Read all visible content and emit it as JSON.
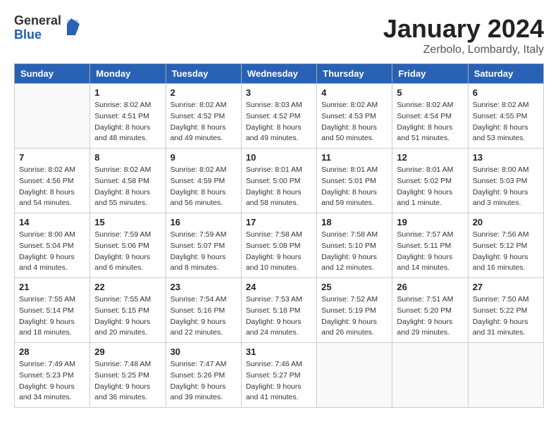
{
  "logo": {
    "general": "General",
    "blue": "Blue"
  },
  "title": "January 2024",
  "location": "Zerbolo, Lombardy, Italy",
  "days_of_week": [
    "Sunday",
    "Monday",
    "Tuesday",
    "Wednesday",
    "Thursday",
    "Friday",
    "Saturday"
  ],
  "weeks": [
    [
      {
        "num": "",
        "rise": "",
        "set": "",
        "daylight": ""
      },
      {
        "num": "1",
        "rise": "Sunrise: 8:02 AM",
        "set": "Sunset: 4:51 PM",
        "daylight": "Daylight: 8 hours and 48 minutes."
      },
      {
        "num": "2",
        "rise": "Sunrise: 8:02 AM",
        "set": "Sunset: 4:52 PM",
        "daylight": "Daylight: 8 hours and 49 minutes."
      },
      {
        "num": "3",
        "rise": "Sunrise: 8:03 AM",
        "set": "Sunset: 4:52 PM",
        "daylight": "Daylight: 8 hours and 49 minutes."
      },
      {
        "num": "4",
        "rise": "Sunrise: 8:02 AM",
        "set": "Sunset: 4:53 PM",
        "daylight": "Daylight: 8 hours and 50 minutes."
      },
      {
        "num": "5",
        "rise": "Sunrise: 8:02 AM",
        "set": "Sunset: 4:54 PM",
        "daylight": "Daylight: 8 hours and 51 minutes."
      },
      {
        "num": "6",
        "rise": "Sunrise: 8:02 AM",
        "set": "Sunset: 4:55 PM",
        "daylight": "Daylight: 8 hours and 53 minutes."
      }
    ],
    [
      {
        "num": "7",
        "rise": "Sunrise: 8:02 AM",
        "set": "Sunset: 4:56 PM",
        "daylight": "Daylight: 8 hours and 54 minutes."
      },
      {
        "num": "8",
        "rise": "Sunrise: 8:02 AM",
        "set": "Sunset: 4:58 PM",
        "daylight": "Daylight: 8 hours and 55 minutes."
      },
      {
        "num": "9",
        "rise": "Sunrise: 8:02 AM",
        "set": "Sunset: 4:59 PM",
        "daylight": "Daylight: 8 hours and 56 minutes."
      },
      {
        "num": "10",
        "rise": "Sunrise: 8:01 AM",
        "set": "Sunset: 5:00 PM",
        "daylight": "Daylight: 8 hours and 58 minutes."
      },
      {
        "num": "11",
        "rise": "Sunrise: 8:01 AM",
        "set": "Sunset: 5:01 PM",
        "daylight": "Daylight: 8 hours and 59 minutes."
      },
      {
        "num": "12",
        "rise": "Sunrise: 8:01 AM",
        "set": "Sunset: 5:02 PM",
        "daylight": "Daylight: 9 hours and 1 minute."
      },
      {
        "num": "13",
        "rise": "Sunrise: 8:00 AM",
        "set": "Sunset: 5:03 PM",
        "daylight": "Daylight: 9 hours and 3 minutes."
      }
    ],
    [
      {
        "num": "14",
        "rise": "Sunrise: 8:00 AM",
        "set": "Sunset: 5:04 PM",
        "daylight": "Daylight: 9 hours and 4 minutes."
      },
      {
        "num": "15",
        "rise": "Sunrise: 7:59 AM",
        "set": "Sunset: 5:06 PM",
        "daylight": "Daylight: 9 hours and 6 minutes."
      },
      {
        "num": "16",
        "rise": "Sunrise: 7:59 AM",
        "set": "Sunset: 5:07 PM",
        "daylight": "Daylight: 9 hours and 8 minutes."
      },
      {
        "num": "17",
        "rise": "Sunrise: 7:58 AM",
        "set": "Sunset: 5:08 PM",
        "daylight": "Daylight: 9 hours and 10 minutes."
      },
      {
        "num": "18",
        "rise": "Sunrise: 7:58 AM",
        "set": "Sunset: 5:10 PM",
        "daylight": "Daylight: 9 hours and 12 minutes."
      },
      {
        "num": "19",
        "rise": "Sunrise: 7:57 AM",
        "set": "Sunset: 5:11 PM",
        "daylight": "Daylight: 9 hours and 14 minutes."
      },
      {
        "num": "20",
        "rise": "Sunrise: 7:56 AM",
        "set": "Sunset: 5:12 PM",
        "daylight": "Daylight: 9 hours and 16 minutes."
      }
    ],
    [
      {
        "num": "21",
        "rise": "Sunrise: 7:55 AM",
        "set": "Sunset: 5:14 PM",
        "daylight": "Daylight: 9 hours and 18 minutes."
      },
      {
        "num": "22",
        "rise": "Sunrise: 7:55 AM",
        "set": "Sunset: 5:15 PM",
        "daylight": "Daylight: 9 hours and 20 minutes."
      },
      {
        "num": "23",
        "rise": "Sunrise: 7:54 AM",
        "set": "Sunset: 5:16 PM",
        "daylight": "Daylight: 9 hours and 22 minutes."
      },
      {
        "num": "24",
        "rise": "Sunrise: 7:53 AM",
        "set": "Sunset: 5:18 PM",
        "daylight": "Daylight: 9 hours and 24 minutes."
      },
      {
        "num": "25",
        "rise": "Sunrise: 7:52 AM",
        "set": "Sunset: 5:19 PM",
        "daylight": "Daylight: 9 hours and 26 minutes."
      },
      {
        "num": "26",
        "rise": "Sunrise: 7:51 AM",
        "set": "Sunset: 5:20 PM",
        "daylight": "Daylight: 9 hours and 29 minutes."
      },
      {
        "num": "27",
        "rise": "Sunrise: 7:50 AM",
        "set": "Sunset: 5:22 PM",
        "daylight": "Daylight: 9 hours and 31 minutes."
      }
    ],
    [
      {
        "num": "28",
        "rise": "Sunrise: 7:49 AM",
        "set": "Sunset: 5:23 PM",
        "daylight": "Daylight: 9 hours and 34 minutes."
      },
      {
        "num": "29",
        "rise": "Sunrise: 7:48 AM",
        "set": "Sunset: 5:25 PM",
        "daylight": "Daylight: 9 hours and 36 minutes."
      },
      {
        "num": "30",
        "rise": "Sunrise: 7:47 AM",
        "set": "Sunset: 5:26 PM",
        "daylight": "Daylight: 9 hours and 39 minutes."
      },
      {
        "num": "31",
        "rise": "Sunrise: 7:46 AM",
        "set": "Sunset: 5:27 PM",
        "daylight": "Daylight: 9 hours and 41 minutes."
      },
      {
        "num": "",
        "rise": "",
        "set": "",
        "daylight": ""
      },
      {
        "num": "",
        "rise": "",
        "set": "",
        "daylight": ""
      },
      {
        "num": "",
        "rise": "",
        "set": "",
        "daylight": ""
      }
    ]
  ]
}
